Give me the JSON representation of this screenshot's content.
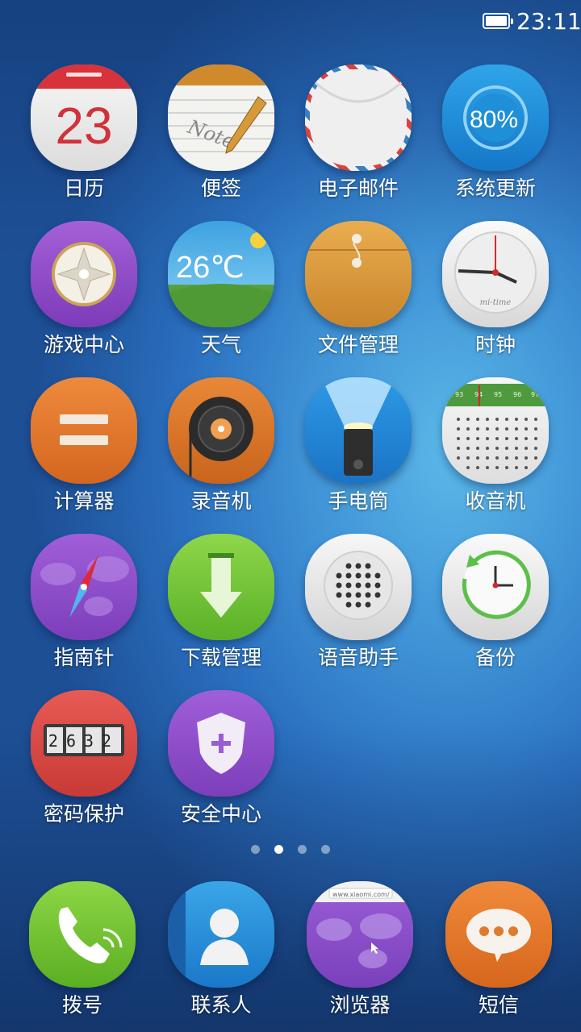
{
  "status_bar": {
    "time": "23:11",
    "battery_icon": "battery-full-icon"
  },
  "apps": [
    {
      "label": "日历",
      "icon": "calendar-icon",
      "badge_text": "23"
    },
    {
      "label": "便签",
      "icon": "notes-icon",
      "badge_text": "Note"
    },
    {
      "label": "电子邮件",
      "icon": "email-envelope-icon"
    },
    {
      "label": "系统更新",
      "icon": "system-update-icon",
      "badge_text": "80%"
    },
    {
      "label": "游戏中心",
      "icon": "game-dpad-icon"
    },
    {
      "label": "天气",
      "icon": "weather-icon",
      "badge_text": "26℃"
    },
    {
      "label": "文件管理",
      "icon": "file-folder-icon"
    },
    {
      "label": "时钟",
      "icon": "clock-icon",
      "badge_text": "mi-time"
    },
    {
      "label": "计算器",
      "icon": "calculator-icon"
    },
    {
      "label": "录音机",
      "icon": "recorder-reel-icon"
    },
    {
      "label": "手电筒",
      "icon": "flashlight-icon"
    },
    {
      "label": "收音机",
      "icon": "radio-icon",
      "dial_ticks": [
        "93",
        "94",
        "95",
        "96",
        "97"
      ]
    },
    {
      "label": "指南针",
      "icon": "compass-icon"
    },
    {
      "label": "下载管理",
      "icon": "download-arrow-icon"
    },
    {
      "label": "语音助手",
      "icon": "voice-speaker-icon"
    },
    {
      "label": "备份",
      "icon": "backup-clock-icon"
    },
    {
      "label": "密码保护",
      "icon": "password-lock-icon",
      "badge_text": "2632"
    },
    {
      "label": "安全中心",
      "icon": "security-shield-icon"
    }
  ],
  "pager": {
    "count": 4,
    "active_index": 1
  },
  "dock": [
    {
      "label": "拨号",
      "icon": "phone-icon"
    },
    {
      "label": "联系人",
      "icon": "contacts-icon"
    },
    {
      "label": "浏览器",
      "icon": "browser-globe-icon",
      "badge_text": "www.xiaomi.com/"
    },
    {
      "label": "短信",
      "icon": "message-bubble-icon"
    }
  ]
}
